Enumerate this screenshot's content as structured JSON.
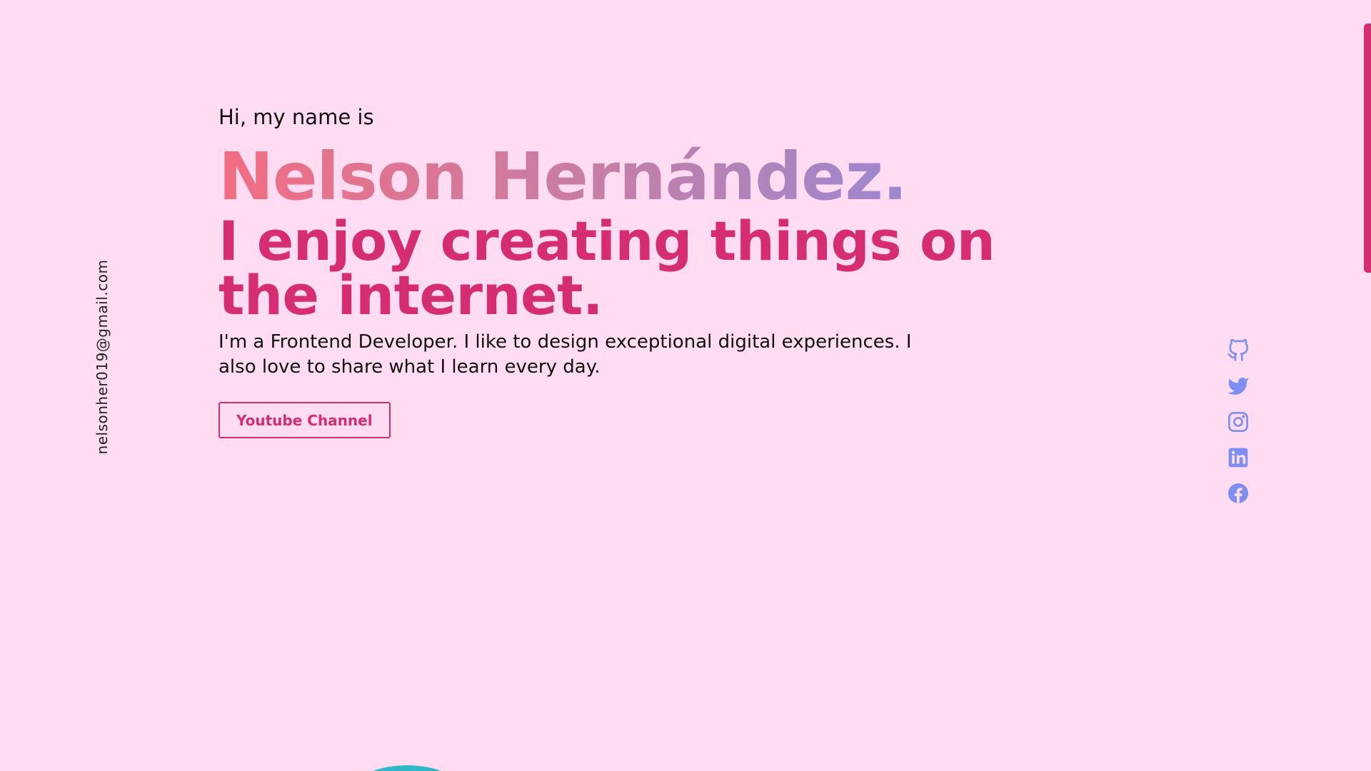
{
  "sidebar": {
    "email": "nelsonher019@gmail.com"
  },
  "hero": {
    "greeting": "Hi, my name is",
    "name": "Nelson Hernández.",
    "tagline": "I enjoy creating things on the internet.",
    "bio": "I'm a Frontend Developer. I like to design exceptional digital experiences. I also love to share what I learn every day.",
    "cta_label": "Youtube Channel"
  },
  "socials": [
    {
      "icon": "github-icon"
    },
    {
      "icon": "twitter-icon"
    },
    {
      "icon": "instagram-icon"
    },
    {
      "icon": "linkedin-icon"
    },
    {
      "icon": "facebook-icon"
    }
  ],
  "colors": {
    "background": "#ffdcf1",
    "accent": "#d52d70",
    "icon": "#7e8ef3",
    "name_gradient_start": "#f26d83",
    "name_gradient_end": "#858ee8"
  }
}
